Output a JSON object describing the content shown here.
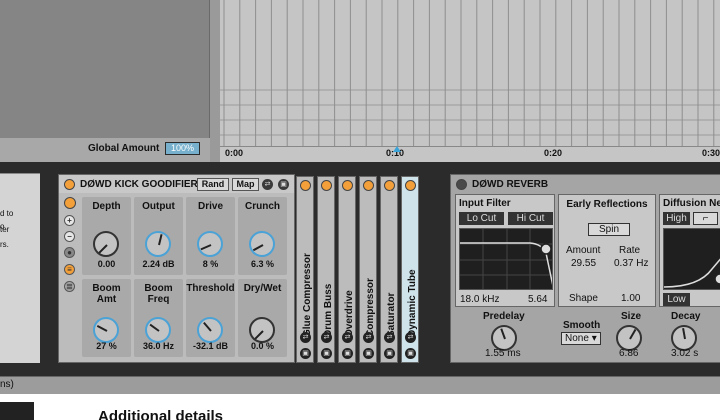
{
  "arrangement": {
    "global_amount_label": "Global Amount",
    "global_amount_value": "100%",
    "ruler_marks": [
      "0:00",
      "0:10",
      "0:20",
      "0:30"
    ]
  },
  "left_clip_lines": [
    "d to",
    "o",
    "ter",
    "rs."
  ],
  "kick_device": {
    "title": "DØWD KICK GOODIFIER",
    "rand_label": "Rand",
    "map_label": "Map",
    "macros": [
      {
        "name": "Depth",
        "value": "0.00",
        "level": 0.0
      },
      {
        "name": "Output",
        "value": "2.24 dB",
        "level": 0.55
      },
      {
        "name": "Drive",
        "value": "8 %",
        "level": 0.08
      },
      {
        "name": "Crunch",
        "value": "6.3 %",
        "level": 0.06
      },
      {
        "name": "Boom Amt",
        "value": "27 %",
        "level": 0.27
      },
      {
        "name": "Boom Freq",
        "value": "36.0 Hz",
        "level": 0.3
      },
      {
        "name": "Threshold",
        "value": "-32.1 dB",
        "level": 0.35
      },
      {
        "name": "Dry/Wet",
        "value": "0.0 %",
        "level": 0.0
      }
    ],
    "chain_devices": [
      "Glue Compressor",
      "Drum Buss",
      "Overdrive",
      "Compressor",
      "Saturator",
      "Dynamic Tube"
    ]
  },
  "reverb_device": {
    "title": "DØWD REVERB",
    "input_filter": {
      "title": "Input Filter",
      "lo_cut_label": "Lo Cut",
      "hi_cut_label": "Hi Cut",
      "freq": "18.0 kHz",
      "q": "5.64"
    },
    "early_reflections": {
      "title": "Early Reflections",
      "spin_label": "Spin",
      "amount_label": "Amount",
      "amount_value": "29.55",
      "rate_label": "Rate",
      "rate_value": "0.37 Hz",
      "shape_label": "Shape",
      "shape_value": "1.00"
    },
    "diffusion": {
      "title": "Diffusion Ne",
      "high_label": "High",
      "low_label": "Low"
    },
    "predelay_label": "Predelay",
    "predelay_value": "1.55 ms",
    "smooth_label": "Smooth",
    "smooth_value": "None",
    "size_label": "Size",
    "size_value": "6.86",
    "decay_label": "Decay",
    "decay_value": "3.02 s"
  },
  "footer": {
    "status_text": "ns)",
    "page_heading": "Additional details"
  },
  "colors": {
    "accent_orange": "#f3a03a",
    "accent_blue": "#4ba2d6",
    "global_amount_bg": "#76b0cc"
  }
}
